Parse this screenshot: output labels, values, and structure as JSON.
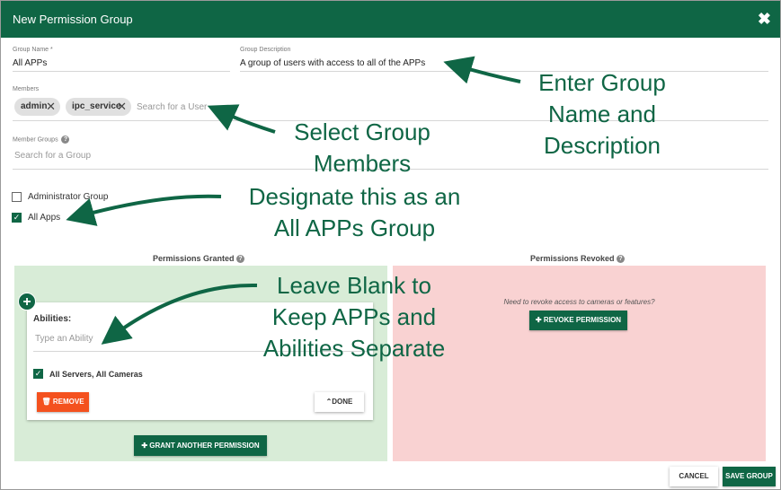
{
  "header": {
    "title": "New Permission Group",
    "close_glyph": "✖"
  },
  "form": {
    "group_name_label": "Group Name *",
    "group_name_value": "All APPs",
    "group_description_label": "Group Description",
    "group_description_value": "A group of users with access to all of the APPs",
    "members_label": "Members",
    "members": [
      {
        "name": "admin"
      },
      {
        "name": "ipc_service"
      }
    ],
    "member_search_placeholder": "Search for a User",
    "member_groups_label": "Member Groups",
    "member_groups_placeholder": "Search for a Group",
    "administrator_group_label": "Administrator Group",
    "administrator_group_checked": false,
    "all_apps_label": "All Apps",
    "all_apps_checked": true
  },
  "permissions": {
    "granted_title": "Permissions Granted",
    "revoked_title": "Permissions Revoked",
    "abilities_label": "Abilities:",
    "abilities_placeholder": "Type an Ability",
    "all_servers_label": "All Servers, All Cameras",
    "all_servers_checked": true,
    "remove_label": "REMOVE",
    "done_label": "DONE",
    "grant_another_label": "GRANT ANOTHER PERMISSION",
    "revoke_prompt": "Need to revoke access to cameras or features?",
    "revoke_label": "REVOKE PERMISSION"
  },
  "footer": {
    "cancel_label": "CANCEL",
    "save_label": "SAVE GROUP"
  },
  "callouts": {
    "enter_group": "Enter Group",
    "name_and": "Name and",
    "description": "Description",
    "select_group": "Select Group",
    "members": "Members",
    "designate": "Designate this as an",
    "all_apps_group": "All APPs Group",
    "leave_blank": "Leave Blank to",
    "keep_apps": "Keep APPs and",
    "abilities_separate": "Abilities Separate"
  },
  "colors": {
    "brand_green": "#0f6645",
    "granted_bg": "#d8ecd7",
    "revoked_bg": "#f9d2d2",
    "remove_orange": "#f4511e"
  },
  "icons": [
    "close-icon",
    "chip-remove-icon",
    "help-icon",
    "plus-circle-icon",
    "trash-icon",
    "chevron-up-icon",
    "plus-icon",
    "checkbox-icon"
  ]
}
